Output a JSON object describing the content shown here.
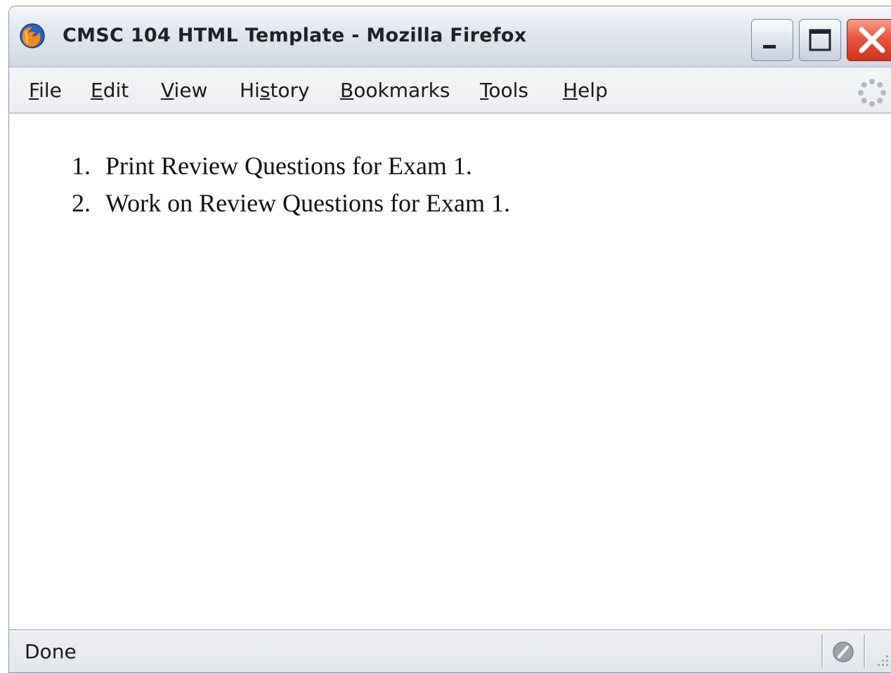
{
  "window": {
    "title": "CMSC 104 HTML Template - Mozilla Firefox"
  },
  "menu": [
    {
      "label": "File",
      "accel_index": 0
    },
    {
      "label": "Edit",
      "accel_index": 0
    },
    {
      "label": "View",
      "accel_index": 0
    },
    {
      "label": "History",
      "accel_index": 2
    },
    {
      "label": "Bookmarks",
      "accel_index": 0
    },
    {
      "label": "Tools",
      "accel_index": 0
    },
    {
      "label": "Help",
      "accel_index": 0
    }
  ],
  "content": {
    "list": [
      {
        "number": "1.",
        "text": "Print Review Questions for Exam 1."
      },
      {
        "number": "2.",
        "text": "Work on Review Questions for Exam 1."
      }
    ]
  },
  "statusbar": {
    "text": "Done"
  },
  "icons": {
    "app": "firefox-icon",
    "minimize": "minimize-icon",
    "maximize": "maximize-icon",
    "close": "close-icon",
    "throbber": "throbber-icon",
    "security": "security-icon",
    "grip": "resize-grip-icon"
  },
  "colors": {
    "close_button": "#e8553c",
    "titlebar": "#e3e7ef",
    "window_border": "#8c96a8"
  }
}
